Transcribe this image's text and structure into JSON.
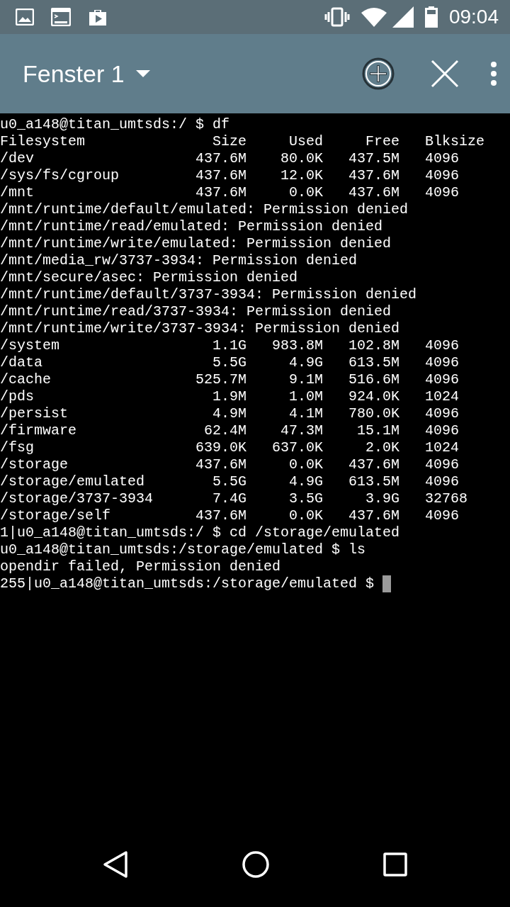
{
  "status_bar": {
    "time": "09:04"
  },
  "app_bar": {
    "title": "Fenster 1"
  },
  "terminal": {
    "lines": [
      {
        "kind": "text",
        "text": "u0_a148@titan_umtsds:/ $ df"
      },
      {
        "kind": "header",
        "cells": [
          "Filesystem",
          "Size",
          "Used",
          "Free",
          "Blksize"
        ]
      },
      {
        "kind": "row",
        "cells": [
          "/dev",
          "437.6M",
          "80.0K",
          "437.5M",
          "4096"
        ]
      },
      {
        "kind": "row",
        "cells": [
          "/sys/fs/cgroup",
          "437.6M",
          "12.0K",
          "437.6M",
          "4096"
        ]
      },
      {
        "kind": "row",
        "cells": [
          "/mnt",
          "437.6M",
          "0.0K",
          "437.6M",
          "4096"
        ]
      },
      {
        "kind": "text",
        "text": "/mnt/runtime/default/emulated: Permission denied"
      },
      {
        "kind": "text",
        "text": "/mnt/runtime/read/emulated: Permission denied"
      },
      {
        "kind": "text",
        "text": "/mnt/runtime/write/emulated: Permission denied"
      },
      {
        "kind": "text",
        "text": "/mnt/media_rw/3737-3934: Permission denied"
      },
      {
        "kind": "text",
        "text": "/mnt/secure/asec: Permission denied"
      },
      {
        "kind": "text",
        "text": "/mnt/runtime/default/3737-3934: Permission denied"
      },
      {
        "kind": "text",
        "text": "/mnt/runtime/read/3737-3934: Permission denied"
      },
      {
        "kind": "text",
        "text": "/mnt/runtime/write/3737-3934: Permission denied"
      },
      {
        "kind": "row",
        "cells": [
          "/system",
          "1.1G",
          "983.8M",
          "102.8M",
          "4096"
        ]
      },
      {
        "kind": "row",
        "cells": [
          "/data",
          "5.5G",
          "4.9G",
          "613.5M",
          "4096"
        ]
      },
      {
        "kind": "row",
        "cells": [
          "/cache",
          "525.7M",
          "9.1M",
          "516.6M",
          "4096"
        ]
      },
      {
        "kind": "row",
        "cells": [
          "/pds",
          "1.9M",
          "1.0M",
          "924.0K",
          "1024"
        ]
      },
      {
        "kind": "row",
        "cells": [
          "/persist",
          "4.9M",
          "4.1M",
          "780.0K",
          "4096"
        ]
      },
      {
        "kind": "row",
        "cells": [
          "/firmware",
          "62.4M",
          "47.3M",
          "15.1M",
          "4096"
        ]
      },
      {
        "kind": "row",
        "cells": [
          "/fsg",
          "639.0K",
          "637.0K",
          "2.0K",
          "1024"
        ]
      },
      {
        "kind": "row",
        "cells": [
          "/storage",
          "437.6M",
          "0.0K",
          "437.6M",
          "4096"
        ]
      },
      {
        "kind": "row",
        "cells": [
          "/storage/emulated",
          "5.5G",
          "4.9G",
          "613.5M",
          "4096"
        ]
      },
      {
        "kind": "row",
        "cells": [
          "/storage/3737-3934",
          "7.4G",
          "3.5G",
          "3.9G",
          "32768"
        ]
      },
      {
        "kind": "row",
        "cells": [
          "/storage/self",
          "437.6M",
          "0.0K",
          "437.6M",
          "4096"
        ]
      },
      {
        "kind": "text",
        "text": "1|u0_a148@titan_umtsds:/ $ cd /storage/emulated"
      },
      {
        "kind": "text",
        "text": "u0_a148@titan_umtsds:/storage/emulated $ ls"
      },
      {
        "kind": "text",
        "text": "opendir failed, Permission denied"
      },
      {
        "kind": "prompt",
        "text": "255|u0_a148@titan_umtsds:/storage/emulated $"
      }
    ]
  }
}
